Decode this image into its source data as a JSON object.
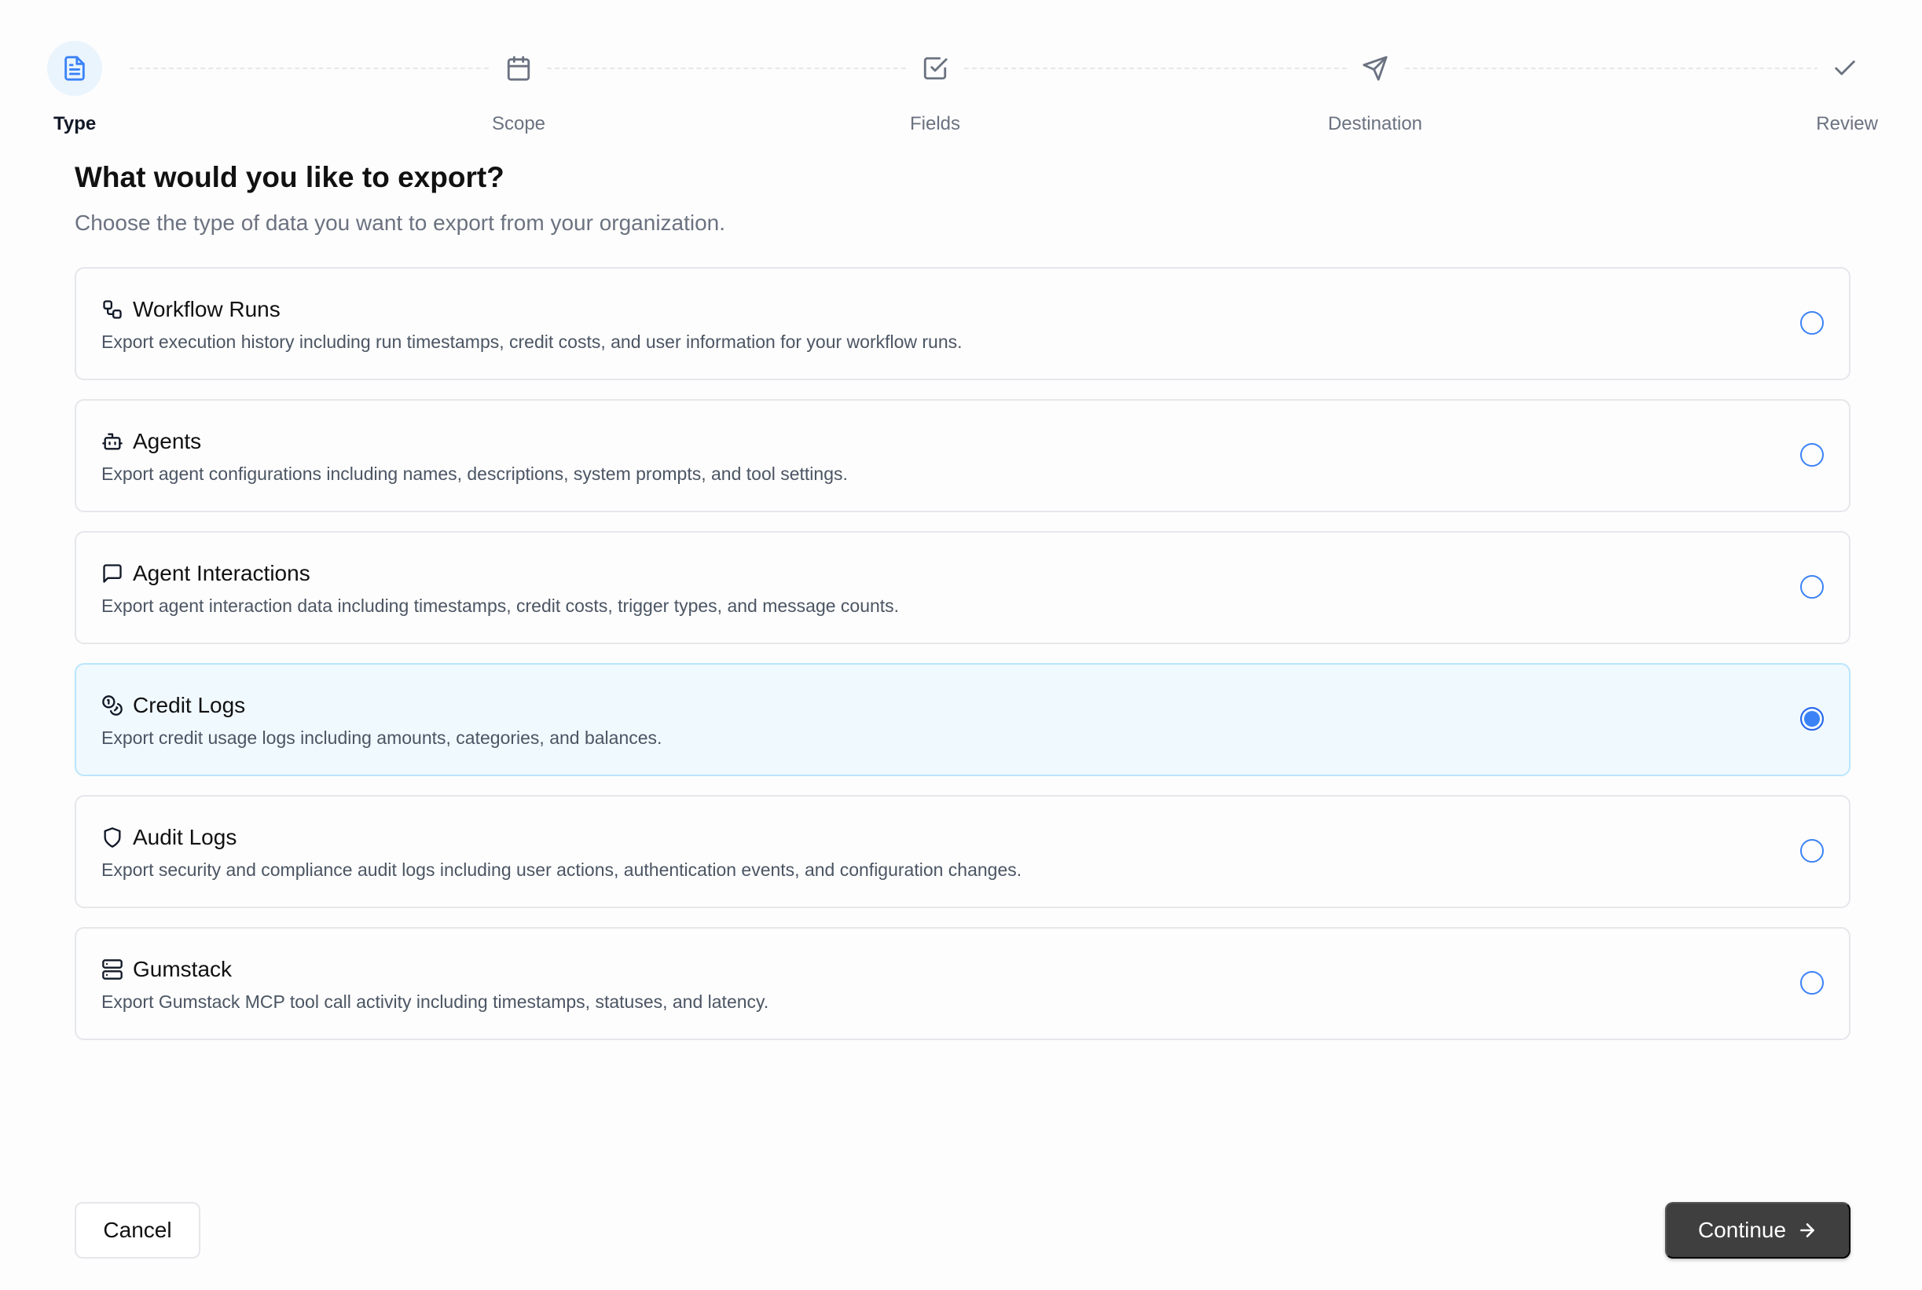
{
  "stepper": {
    "steps": [
      {
        "label": "Type",
        "icon": "file-text-icon",
        "active": true
      },
      {
        "label": "Scope",
        "icon": "calendar-icon",
        "active": false
      },
      {
        "label": "Fields",
        "icon": "checkbox-icon",
        "active": false
      },
      {
        "label": "Destination",
        "icon": "send-icon",
        "active": false
      },
      {
        "label": "Review",
        "icon": "check-icon",
        "active": false
      }
    ]
  },
  "main": {
    "title": "What would you like to export?",
    "subtitle": "Choose the type of data you want to export from your organization."
  },
  "options": [
    {
      "title": "Workflow Runs",
      "icon": "workflow-icon",
      "description": "Export execution history including run timestamps, credit costs, and user information for your workflow runs.",
      "selected": false
    },
    {
      "title": "Agents",
      "icon": "bot-icon",
      "description": "Export agent configurations including names, descriptions, system prompts, and tool settings.",
      "selected": false
    },
    {
      "title": "Agent Interactions",
      "icon": "message-square-icon",
      "description": "Export agent interaction data including timestamps, credit costs, trigger types, and message counts.",
      "selected": false
    },
    {
      "title": "Credit Logs",
      "icon": "coins-icon",
      "description": "Export credit usage logs including amounts, categories, and balances.",
      "selected": true
    },
    {
      "title": "Audit Logs",
      "icon": "shield-icon",
      "description": "Export security and compliance audit logs including user actions, authentication events, and configuration changes.",
      "selected": false
    },
    {
      "title": "Gumstack",
      "icon": "server-icon",
      "description": "Export Gumstack MCP tool call activity including timestamps, statuses, and latency.",
      "selected": false
    }
  ],
  "footer": {
    "cancel_label": "Cancel",
    "continue_label": "Continue"
  },
  "colors": {
    "accent": "#3b82f6",
    "selected_bg": "#f0f9fe",
    "selected_border": "#bae6fd",
    "primary_button": "#3f3f3f"
  }
}
